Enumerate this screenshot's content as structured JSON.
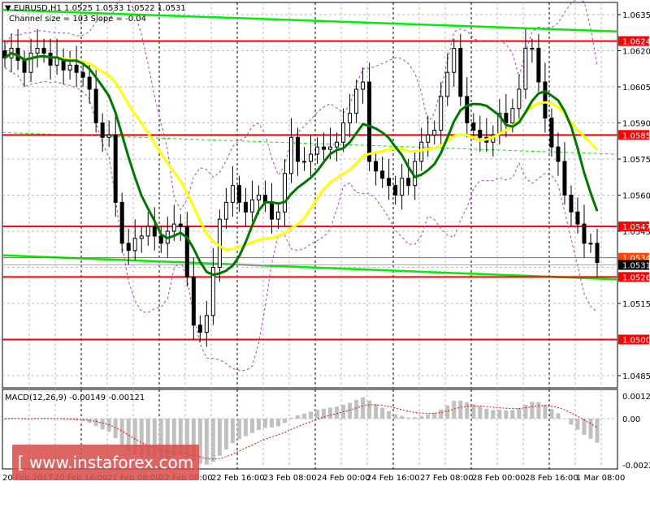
{
  "header": {
    "symbol": "EURUSD,H1",
    "ohlc": "1.0525 1.0533 1:0522 1.0531",
    "indicator_note": "Channel size = 103 Slope = -0.04"
  },
  "colors": {
    "level": "#ff0000",
    "orange_level": "#ff4500",
    "channel": "#00ee00",
    "ma_fast": "#007700",
    "ma_slow": "#ffff00",
    "bands": "#b040d0",
    "macd_hist": "#c0c0c0",
    "macd_signal": "#ff0000"
  },
  "chart_data": {
    "type": "candlestick",
    "title": "EURUSD,H1",
    "ylim": [
      1.0478,
      1.065
    ],
    "y_ticks": [
      "1.0635",
      "1.0620",
      "1.0605",
      "1.0590",
      "1.0575",
      "1.0560",
      "1.0545",
      "1.0515",
      "1.0485"
    ],
    "x_ticks": [
      "20 Feb 2017",
      "20 Feb 16:00",
      "21 Feb 08:00",
      "22 Feb 00:00",
      "22 Feb 16:00",
      "23 Feb 08:00",
      "24 Feb 00:00",
      "24 Feb 16:00",
      "27 Feb 08:00",
      "28 Feb 00:00",
      "28 Feb 16:00",
      "1 Mar 08:00"
    ],
    "closes": [
      1.0617,
      1.0621,
      1.0616,
      1.0611,
      1.0619,
      1.0621,
      1.0619,
      1.0614,
      1.0617,
      1.0612,
      1.0614,
      1.0611,
      1.0609,
      1.0604,
      1.059,
      1.0584,
      1.0585,
      1.0557,
      1.054,
      1.0537,
      1.0542,
      1.0543,
      1.0547,
      1.0543,
      1.054,
      1.0545,
      1.0548,
      1.0547,
      1.0526,
      1.0506,
      1.0503,
      1.051,
      1.053,
      1.055,
      1.0557,
      1.0564,
      1.0557,
      1.0553,
      1.0558,
      1.056,
      1.0557,
      1.055,
      1.0553,
      1.0569,
      1.0584,
      1.0574,
      1.0574,
      1.0577,
      1.058,
      1.0579,
      1.058,
      1.0582,
      1.059,
      1.0594,
      1.0604,
      1.0607,
      1.0574,
      1.057,
      1.0567,
      1.0564,
      1.056,
      1.0567,
      1.0564,
      1.0574,
      1.0582,
      1.0585,
      1.0587,
      1.0601,
      1.0611,
      1.0621,
      1.0601,
      1.059,
      1.0587,
      1.0584,
      1.0582,
      1.0585,
      1.0594,
      1.059,
      1.0596,
      1.0604,
      1.0621,
      1.0621,
      1.0607,
      1.0592,
      1.058,
      1.0574,
      1.056,
      1.0553,
      1.0548,
      1.054,
      1.054,
      1.0532
    ],
    "levels": [
      {
        "label": "1.0624",
        "value": 1.0624,
        "kind": "level"
      },
      {
        "label": "1.0585",
        "value": 1.0585,
        "kind": "level"
      },
      {
        "label": "1.0547",
        "value": 1.0547,
        "kind": "level"
      },
      {
        "label": "1.0534",
        "value": 1.0534,
        "kind": "orange"
      },
      {
        "label": "1.0526",
        "value": 1.0526,
        "kind": "level"
      },
      {
        "label": "1.0500",
        "value": 1.05,
        "kind": "level"
      }
    ],
    "current_price": {
      "label": "1.0531",
      "value": 1.0531
    },
    "channel": {
      "top": [
        1.0637,
        1.0628
      ],
      "bottom": [
        1.0535,
        1.0525
      ],
      "middle": [
        1.0586,
        1.0577
      ]
    },
    "ma_periods": {
      "fast": 8,
      "slow": 18
    },
    "macd": {
      "label": "MACD(12,26,9) -0.00149 -0.00121",
      "y_ticks": [
        "0.00123",
        "0.00",
        "-0.00221"
      ],
      "ylim": [
        -0.00221,
        0.00123
      ]
    }
  },
  "watermark": "[ www.instaforex.com ]"
}
